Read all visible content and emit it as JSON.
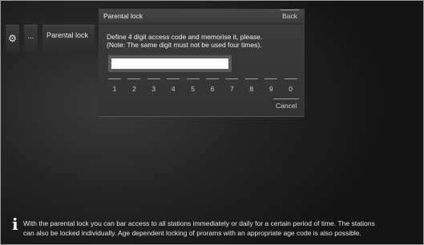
{
  "menu": {
    "gear_icon": "gear-icon",
    "dots_label": "...",
    "parental_label": "Parental lock"
  },
  "dialog": {
    "title": "Parental lock",
    "back_label": "Back",
    "message_line1": "Define 4 digit access code and memorise it, please.",
    "message_line2": "(Note: The same digit must not be used four times).",
    "code_value": "",
    "keys": [
      "1",
      "2",
      "3",
      "4",
      "5",
      "6",
      "7",
      "8",
      "9",
      "0"
    ],
    "cancel_label": "Cancel"
  },
  "info": {
    "icon": "info-icon",
    "line1": "With the parental lock you can bar access to all stations immediately or daily for a certain period of time. The stations",
    "line2": "can also be locked individually. Age dependent locking of prorams with an appropriate age code is also possible."
  }
}
